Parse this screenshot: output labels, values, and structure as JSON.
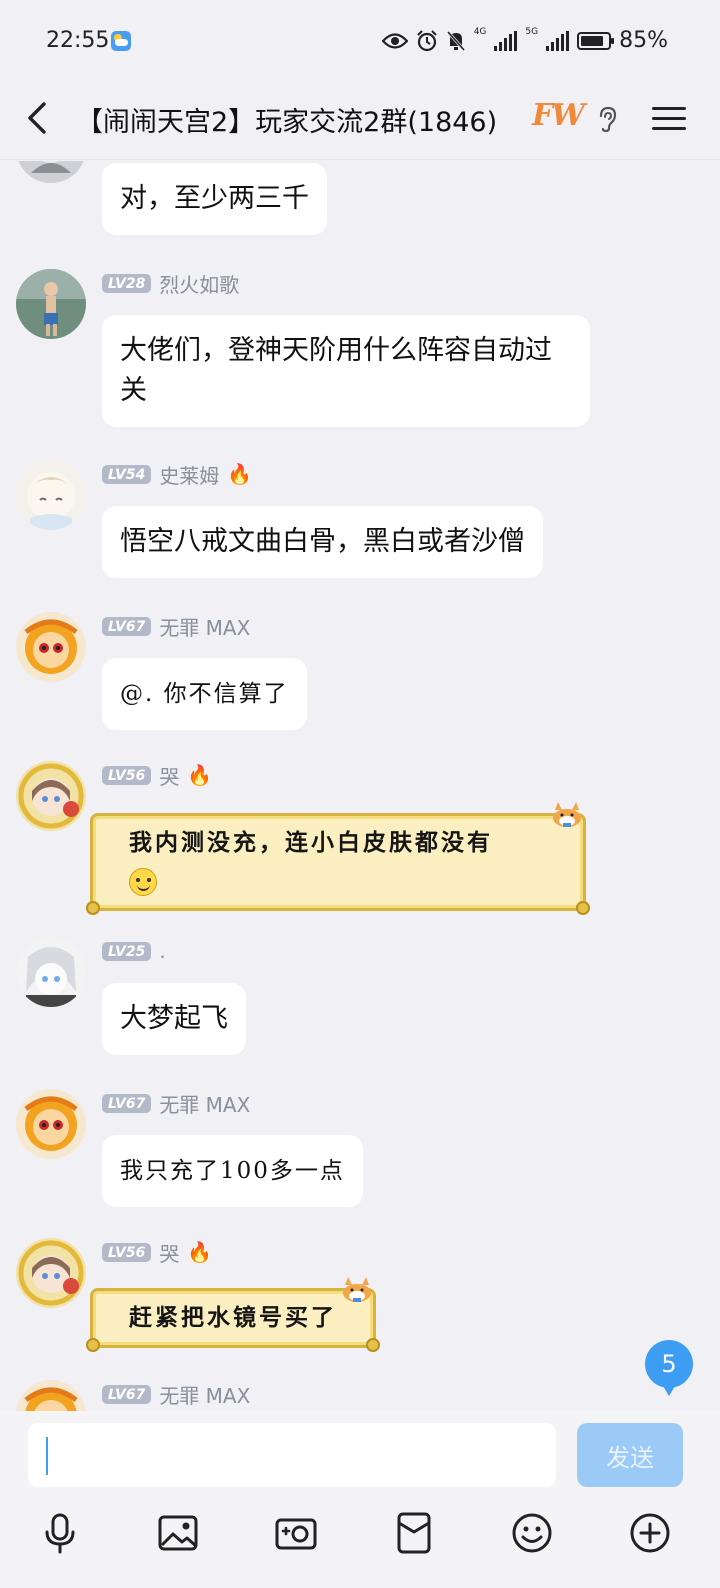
{
  "status_bar": {
    "time": "22:55",
    "net_4g": "4G",
    "net_5g": "5G",
    "battery_percent": "85%",
    "battery_level": 0.85
  },
  "header": {
    "title": "【闹闹天宫2】玩家交流2群(1846)",
    "badge": "FW"
  },
  "messages": [
    {
      "text": "对，至少两三千"
    },
    {
      "level": "LV28",
      "nickname": "烈火如歌",
      "text": "大佬们，登神天阶用什么阵容自动过关"
    },
    {
      "level": "LV54",
      "nickname": "史莱姆",
      "text": "悟空八戒文曲白骨，黑白或者沙僧"
    },
    {
      "level": "LV67",
      "nickname": "无罪 MAX",
      "text": "@. 你不信算了"
    },
    {
      "level": "LV56",
      "nickname": "哭",
      "text": "我内测没充，连小白皮肤都没有"
    },
    {
      "level": "LV25",
      "nickname": ".",
      "text": "大梦起飞"
    },
    {
      "level": "LV67",
      "nickname": "无罪 MAX",
      "text": "我只充了100多一点"
    },
    {
      "level": "LV56",
      "nickname": "哭",
      "text": "赶紧把水镜号买了"
    },
    {
      "level": "LV67",
      "nickname": "无罪 MAX"
    }
  ],
  "unread_count": "5",
  "input": {
    "value": "",
    "send_label": "发送"
  },
  "toolbar": [
    "mic-icon",
    "image-icon",
    "camera-icon",
    "red-packet-icon",
    "emoji-icon",
    "plus-icon"
  ]
}
